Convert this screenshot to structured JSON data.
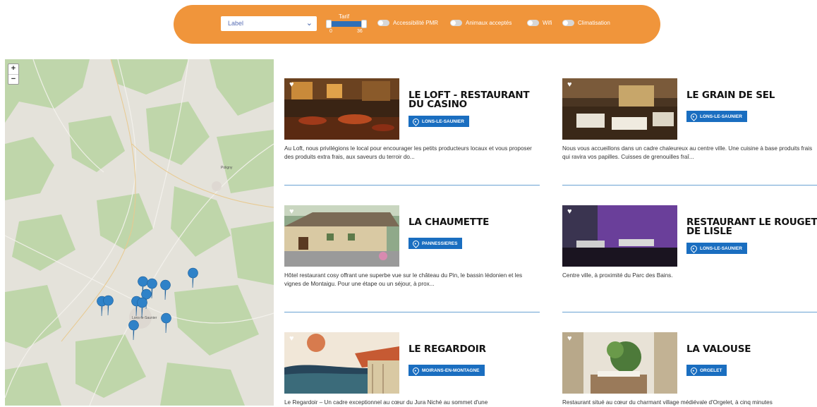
{
  "filters": {
    "select_value": "Label",
    "tarif_label": "Tarif",
    "tarif_min": "0",
    "tarif_max": "36",
    "toggles": [
      "Accessibilité PMR",
      "Animaux acceptés",
      "Wifi",
      "Climatisation"
    ]
  },
  "map": {
    "zoom_in": "+",
    "zoom_out": "−",
    "place_labels": [
      "Poligny",
      "Lons-le-Saunier"
    ]
  },
  "cards": [
    {
      "title": "LE LOFT - RESTAURANT DU CASINO",
      "location": "LONS-LE-SAUNIER",
      "description": "Au Loft, nous privilégions le local pour encourager les petits producteurs locaux et vous proposer des produits extra frais, aux saveurs du terroir do..."
    },
    {
      "title": "LE GRAIN DE SEL",
      "location": "LONS-LE-SAUNIER",
      "description": "Nous vous accueillons dans un cadre chaleureux au centre ville. Une cuisine à base produits frais qui ravira vos papilles. Cuisses de grenouilles fraî..."
    },
    {
      "title": "LA CHAUMETTE",
      "location": "PANNESSIERES",
      "description": "Hôtel restaurant cosy offrant une superbe vue sur le château du Pin, le bassin lédonien et les vignes de Montaigu. Pour une étape ou un séjour, à prox..."
    },
    {
      "title": "RESTAURANT LE ROUGET DE LISLE",
      "location": "LONS-LE-SAUNIER",
      "description": "Centre ville, à proximité du Parc des Bains."
    },
    {
      "title": "LE REGARDOIR",
      "location": "MOIRANS-EN-MONTAGNE",
      "description": "Le Regardoir – Un cadre exceptionnel au cœur du Jura Niché au sommet d'une"
    },
    {
      "title": "LA VALOUSE",
      "location": "ORGELET",
      "description": "Restaurant situé au cœur du charmant village médiévale d'Orgelet, à cinq minutes"
    }
  ]
}
